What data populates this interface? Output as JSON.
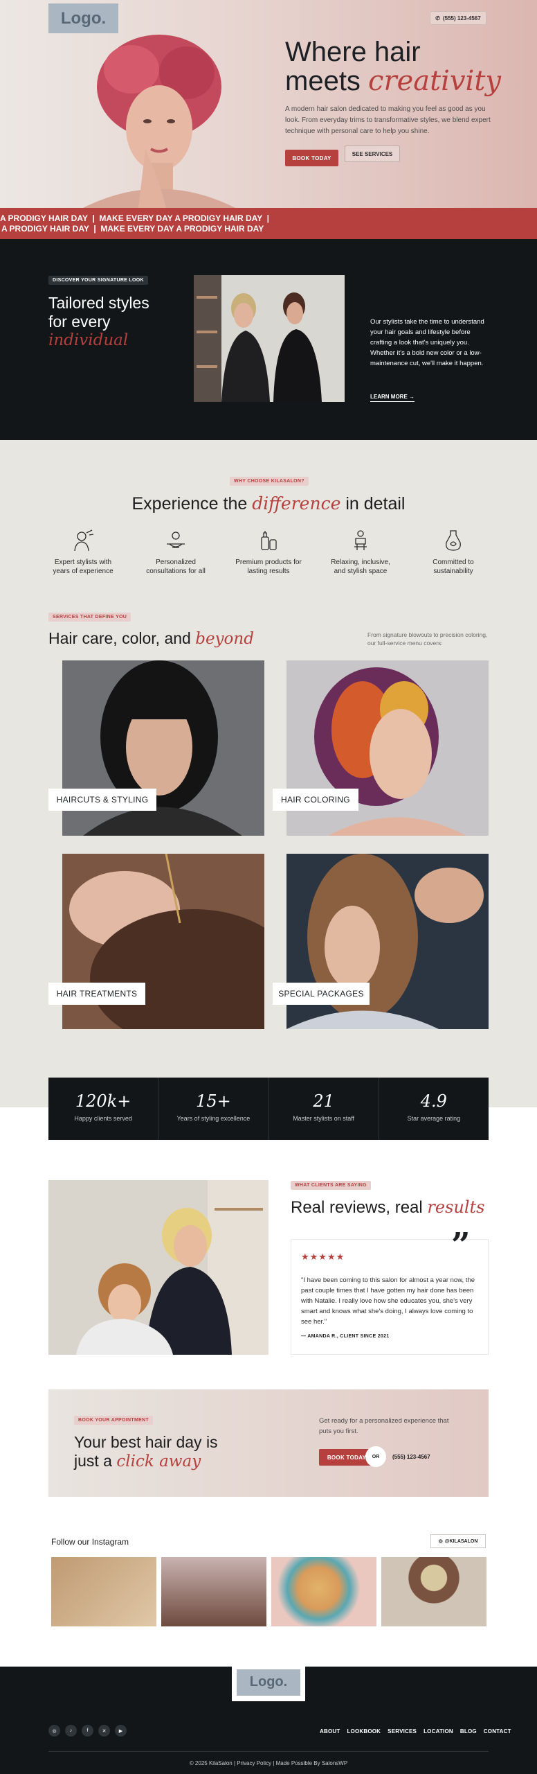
{
  "brand": {
    "logo": "Logo.",
    "accent": "#b5403d",
    "dark": "#121618"
  },
  "header": {
    "phone": "(555) 123-4567"
  },
  "hero": {
    "title_line1": "Where hair",
    "title_line2_plain": "meets ",
    "title_line2_accent": "creativity",
    "subtitle": "A modern hair salon dedicated to making you feel as good as you look. From everyday trims to transformative styles, we blend expert technique with personal care to help you shine.",
    "btn_primary": "BOOK TODAY",
    "btn_secondary": "SEE SERVICES"
  },
  "marquee": {
    "line1": "A PRODIGY HAIR DAY  |  MAKE EVERY DAY A PRODIGY HAIR DAY  |",
    "line2": "A PRODIGY HAIR DAY  |  MAKE EVERY DAY A PRODIGY HAIR DAY"
  },
  "signature": {
    "tag": "DISCOVER YOUR SIGNATURE LOOK",
    "title_line1": "Tailored styles",
    "title_line2": "for every",
    "title_accent": "individual",
    "body": "Our stylists take the time to understand your hair goals and lifestyle before crafting a look that's uniquely you. Whether it's a bold new color or a low-maintenance cut, we'll make it happen.",
    "link": "LEARN MORE"
  },
  "why": {
    "tag": "WHY CHOOSE KILASALON?",
    "title_plain1": "Experience the ",
    "title_accent": "difference",
    "title_plain2": " in detail",
    "features": [
      {
        "icon": "stylist-icon",
        "l1": "Expert stylists with",
        "l2": "years of experience"
      },
      {
        "icon": "consultation-icon",
        "l1": "Personalized",
        "l2": "consultations for all"
      },
      {
        "icon": "products-icon",
        "l1": "Premium products for",
        "l2": "lasting results"
      },
      {
        "icon": "relax-icon",
        "l1": "Relaxing, inclusive,",
        "l2": "and stylish space"
      },
      {
        "icon": "sustainability-icon",
        "l1": "Committed to",
        "l2": "sustainability"
      }
    ]
  },
  "services": {
    "tag": "SERVICES THAT DEFINE YOU",
    "title_plain": "Hair care, color, and ",
    "title_accent": "beyond",
    "side": "From signature blowouts to precision coloring, our full-service menu covers:",
    "items": [
      "HAIRCUTS & STYLING",
      "HAIR COLORING",
      "HAIR TREATMENTS",
      "SPECIAL PACKAGES"
    ]
  },
  "stats": [
    {
      "num": "120k+",
      "lbl": "Happy clients served"
    },
    {
      "num": "15+",
      "lbl": "Years of styling excellence"
    },
    {
      "num": "21",
      "lbl": "Master stylists on staff"
    },
    {
      "num": "4.9",
      "lbl": "Star average rating"
    }
  ],
  "reviews": {
    "tag": "WHAT CLIENTS ARE SAYING",
    "title_plain": "Real reviews, real ",
    "title_accent": "results",
    "stars": "★★★★★",
    "rating": 5,
    "quote": "\"I have been coming to this salon for almost a year now, the past couple times that I have gotten my hair done has been with Natalie. I really love how she educates you, she's very smart and knows what she's doing, I always love coming to see her.\"",
    "author": "— AMANDA R., CLIENT SINCE 2021"
  },
  "cta": {
    "tag": "BOOK YOUR APPOINTMENT",
    "title_line1": "Your best hair day is",
    "title_line2_plain": "just a ",
    "title_accent": "click away",
    "body": "Get ready for a personalized experience that puts you first.",
    "btn": "BOOK TODAY",
    "or": "OR",
    "phone": "(555) 123-4567"
  },
  "instagram": {
    "title": "Follow our Instagram",
    "handle": "@KILASALON"
  },
  "footer": {
    "logo": "Logo.",
    "nav": [
      "ABOUT",
      "LOOKBOOK",
      "SERVICES",
      "LOCATION",
      "BLOG",
      "CONTACT"
    ],
    "copyright": "© 2025 KilaSalon | Privacy Policy | Made Possible By SalonsWP"
  }
}
